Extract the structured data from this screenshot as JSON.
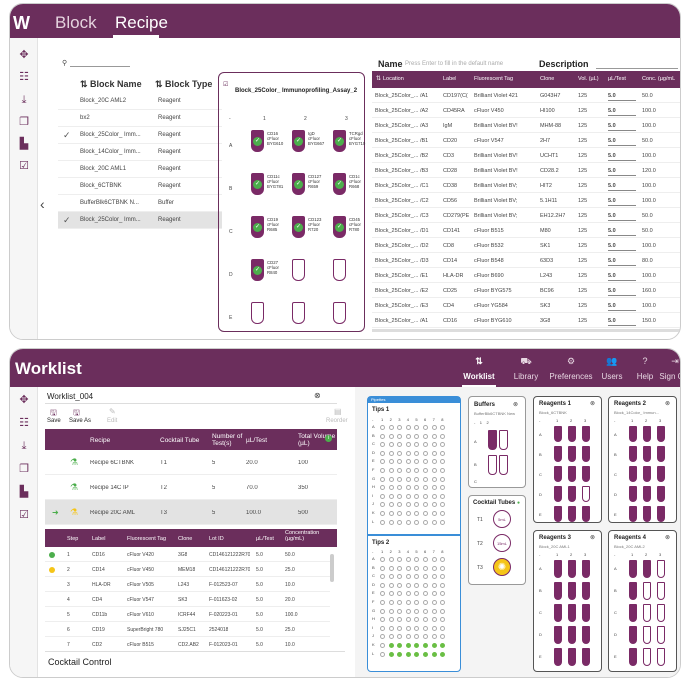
{
  "top": {
    "header": {
      "app_initial": "W",
      "tab_block": "Block",
      "tab_recipe": "Recipe"
    },
    "block_list": {
      "col_name": "Block Name",
      "col_type": "Block Type",
      "rows": [
        {
          "name": "Block_20C AML2",
          "type": "Reagent",
          "checked": false
        },
        {
          "name": "bx2",
          "type": "Reagent",
          "checked": false
        },
        {
          "name": "Block_25Color_ Imm...",
          "type": "Reagent",
          "checked": true
        },
        {
          "name": "Block_14Color_ Imm...",
          "type": "Reagent",
          "checked": false
        },
        {
          "name": "Block_20C AML1",
          "type": "Reagent",
          "checked": false
        },
        {
          "name": "Block_6CTBNK",
          "type": "Reagent",
          "checked": false
        },
        {
          "name": "BufferBlk6CTBNK N...",
          "type": "Buffer",
          "checked": false
        },
        {
          "name": "Block_25Color_ Imm...",
          "type": "Reagent",
          "checked": true
        }
      ]
    },
    "grid": {
      "title": "Block_25Color_ Immunoprofiling_Assay_2",
      "cols": [
        "1",
        "2",
        "3"
      ],
      "rows": [
        "A",
        "B",
        "C",
        "D",
        "E"
      ],
      "cells": [
        [
          "CD16\ncFluor\nBYG610",
          "IgD\ncFluor\nBYG667",
          "TCRgd\ncFluor\nBYG710"
        ],
        [
          "CD11c\ncFluor\nBYG781",
          "CD127\ncFluor\nR659",
          "CD1c\ncFluor\nR668"
        ],
        [
          "CD19\ncFluor\nR685",
          "CD123\ncFluor\nR720",
          "CD45\ncFluor\nR780"
        ],
        [
          "CD27\ncFluor\nR840",
          "",
          ""
        ]
      ]
    },
    "name_label": "Name",
    "name_placeholder": "Press Enter to fill in the default name",
    "desc_label": "Description",
    "table": {
      "headers": [
        "Location",
        "Label",
        "Fluorescent Tag",
        "Clone",
        "Vol. (µL)",
        "µL/Test",
        "Conc. (µg/mL"
      ],
      "rows": [
        [
          "Block_25Color_... /A1",
          "CD197(C(",
          "Brilliant Violet 421",
          "G043H7",
          "125",
          "5.0",
          "50.0"
        ],
        [
          "Block_25Color_... /A2",
          "CD45RA",
          "cFluor V450",
          "HI100",
          "125",
          "5.0",
          "100.0"
        ],
        [
          "Block_25Color_... /A3",
          "IgM",
          "Brilliant Violet BV!",
          "MHM-88",
          "125",
          "5.0",
          "100.0"
        ],
        [
          "Block_25Color_... /B1",
          "CD20",
          "cFluor V547",
          "2H7",
          "125",
          "5.0",
          "50.0"
        ],
        [
          "Block_25Color_... /B2",
          "CD3",
          "Brilliant Violet BV!",
          "UCHT1",
          "125",
          "5.0",
          "100.0"
        ],
        [
          "Block_25Color_... /B3",
          "CD28",
          "Brilliant Violet BV!",
          "CD28.2",
          "125",
          "5.0",
          "120.0"
        ],
        [
          "Block_25Color_... /C1",
          "CD38",
          "Brilliant Violet BV;",
          "HIT2",
          "125",
          "5.0",
          "100.0"
        ],
        [
          "Block_25Color_... /C2",
          "CD56",
          "Brilliant Violet BV;",
          "5.1H11",
          "125",
          "5.0",
          "100.0"
        ],
        [
          "Block_25Color_... /C3",
          "CD279(PE",
          "Brilliant Violet BV;",
          "EH12.2H7",
          "125",
          "5.0",
          "50.0"
        ],
        [
          "Block_25Color_... /D1",
          "CD141",
          "cFluor B515",
          "M80",
          "125",
          "5.0",
          "50.0"
        ],
        [
          "Block_25Color_... /D2",
          "CD8",
          "cFluor B532",
          "SK1",
          "125",
          "5.0",
          "100.0"
        ],
        [
          "Block_25Color_... /D3",
          "CD14",
          "cFluor B548",
          "63D3",
          "125",
          "5.0",
          "80.0"
        ],
        [
          "Block_25Color_... /E1",
          "HLA-DR",
          "cFluor B690",
          "L243",
          "125",
          "5.0",
          "100.0"
        ],
        [
          "Block_25Color_... /E2",
          "CD25",
          "cFluor BYG575",
          "BC96",
          "125",
          "5.0",
          "160.0"
        ],
        [
          "Block_25Color_... /E3",
          "CD4",
          "cFluor YG584",
          "SK3",
          "125",
          "5.0",
          "100.0"
        ],
        [
          "Block_25Color_... /A1",
          "CD16",
          "cFluor BYG610",
          "3G8",
          "125",
          "5.0",
          "150.0"
        ]
      ]
    }
  },
  "bottom": {
    "header": {
      "title": "Worklist",
      "nav": [
        "Worklist",
        "Library",
        "Preferences",
        "Users",
        "Help",
        "Sign Out"
      ]
    },
    "worklist_name": "Worklist_004",
    "toolbar": {
      "save": "Save",
      "save_as": "Save As",
      "edit": "Edit",
      "reorder": "Reorder"
    },
    "recipe_table": {
      "headers": [
        "Recipe",
        "Cocktail Tube",
        "Number of Test(s)",
        "µL/Test",
        "Total Volume (µL)"
      ],
      "rows": [
        [
          "Recipe 6CTBNK",
          "T1",
          "5",
          "20.0",
          "100"
        ],
        [
          "Recipe 14C IP",
          "T2",
          "5",
          "70.0",
          "350"
        ],
        [
          "Recipe 20C AML",
          "T3",
          "5",
          "100.0",
          "500"
        ]
      ]
    },
    "step_table": {
      "headers": [
        "Step",
        "Label",
        "Fluorescent Tag",
        "Clone",
        "Lot ID",
        "µL/Test",
        "Concentration (µg/mL)"
      ],
      "rows": [
        [
          "1",
          "CD16",
          "cFluor V420",
          "3G8",
          "CD146121222R70",
          "5.0",
          "50.0"
        ],
        [
          "2",
          "CD14",
          "cFluor V450",
          "MEM18",
          "CD146121222R70",
          "5.0",
          "25.0"
        ],
        [
          "3",
          "HLA-DR",
          "cFluor V505",
          "L243",
          "F-012523-07",
          "5.0",
          "10.0"
        ],
        [
          "4",
          "CD4",
          "cFluor V547",
          "SK3",
          "F-011623-02",
          "5.0",
          "20.0"
        ],
        [
          "5",
          "CD11b",
          "cFluor V610",
          "ICRF44",
          "F-020223-01",
          "5.0",
          "100.0"
        ],
        [
          "6",
          "CD19",
          "SuperBright 780",
          "SJ25C1",
          "2524018",
          "5.0",
          "25.0"
        ],
        [
          "7",
          "CD2",
          "cFluor B515",
          "CD2.AB2",
          "F-012023-01",
          "5.0",
          "10.0"
        ]
      ]
    },
    "cocktail_control": "Cocktail Control",
    "deck": {
      "pipettes_label": "Pipettes",
      "tips1": "Tips 1",
      "tips2": "Tips 2",
      "buffers": "Buffers",
      "buffers_sub": "BufferBlk6CTBNK New",
      "cocktail_tubes": "Cocktail Tubes",
      "tube_labels": [
        "T1",
        "T2",
        "T3"
      ],
      "tube_vols": [
        "5mL",
        "15mL",
        ""
      ],
      "reagents": [
        {
          "title": "Reagents 1",
          "sub": "Block_6CTBNK"
        },
        {
          "title": "Reagents 2",
          "sub": "Block_14Color_ Immun..."
        },
        {
          "title": "Reagents 3",
          "sub": "Block_20C AML1"
        },
        {
          "title": "Reagents 4",
          "sub": "Block_20C AML2"
        }
      ],
      "well_cols": [
        "1",
        "2",
        "3",
        "4",
        "5",
        "6",
        "7",
        "8"
      ],
      "well_rows": [
        "A",
        "B",
        "C",
        "D",
        "E",
        "F",
        "G",
        "H",
        "I",
        "J",
        "K",
        "L"
      ],
      "plate_cols": [
        "1",
        "2",
        "3"
      ],
      "plate_rows": [
        "A",
        "B",
        "C",
        "D",
        "E"
      ]
    },
    "colors": {
      "brand": "#6b2e5c",
      "accent_green": "#4cae4c",
      "tips_border": "#3a8ed8",
      "warn": "#f5c518"
    }
  }
}
